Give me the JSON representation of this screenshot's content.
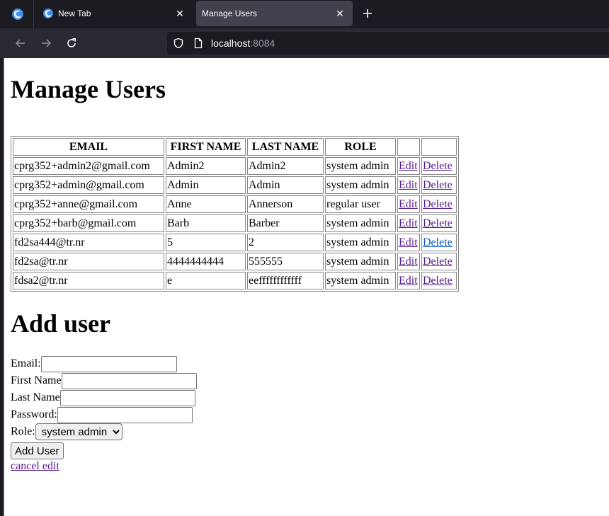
{
  "browser": {
    "tabs": [
      {
        "title": "New Tab",
        "active": false
      },
      {
        "title": "Manage Users",
        "active": true
      }
    ],
    "url_host": "localhost",
    "url_port": ":8084"
  },
  "page": {
    "heading": "Manage Users",
    "table": {
      "headers": [
        "EMAIL",
        "FIRST NAME",
        "LAST NAME",
        "ROLE",
        "",
        ""
      ],
      "rows": [
        {
          "email": "cprg352+admin2@gmail.com",
          "first": "Admin2",
          "last": "Admin2",
          "role": "system admin",
          "edit": "Edit",
          "delete": "Delete"
        },
        {
          "email": "cprg352+admin@gmail.com",
          "first": "Admin",
          "last": "Admin",
          "role": "system admin",
          "edit": "Edit",
          "delete": "Delete"
        },
        {
          "email": "cprg352+anne@gmail.com",
          "first": "Anne",
          "last": "Annerson",
          "role": "regular user",
          "edit": "Edit",
          "delete": "Delete"
        },
        {
          "email": "cprg352+barb@gmail.com",
          "first": "Barb",
          "last": "Barber",
          "role": "system admin",
          "edit": "Edit",
          "delete": "Delete"
        },
        {
          "email": "fd2sa444@tr.nr",
          "first": "5",
          "last": "2",
          "role": "system admin",
          "edit": "Edit",
          "delete": "Delete"
        },
        {
          "email": "fd2sa@tr.nr",
          "first": "4444444444",
          "last": "555555",
          "role": "system admin",
          "edit": "Edit",
          "delete": "Delete"
        },
        {
          "email": "fdsa2@tr.nr",
          "first": "e",
          "last": "eeffffffffffff",
          "role": "system admin",
          "edit": "Edit",
          "delete": "Delete"
        }
      ]
    },
    "add_heading": "Add user",
    "form": {
      "email_label": "Email:",
      "email_value": "",
      "first_label": "First Name",
      "first_value": "",
      "last_label": "Last Name",
      "last_value": "",
      "password_label": "Password:",
      "password_value": "",
      "role_label": "Role:",
      "role_selected": "system admin",
      "submit_label": "Add User",
      "cancel_label": "cancel edit"
    }
  }
}
